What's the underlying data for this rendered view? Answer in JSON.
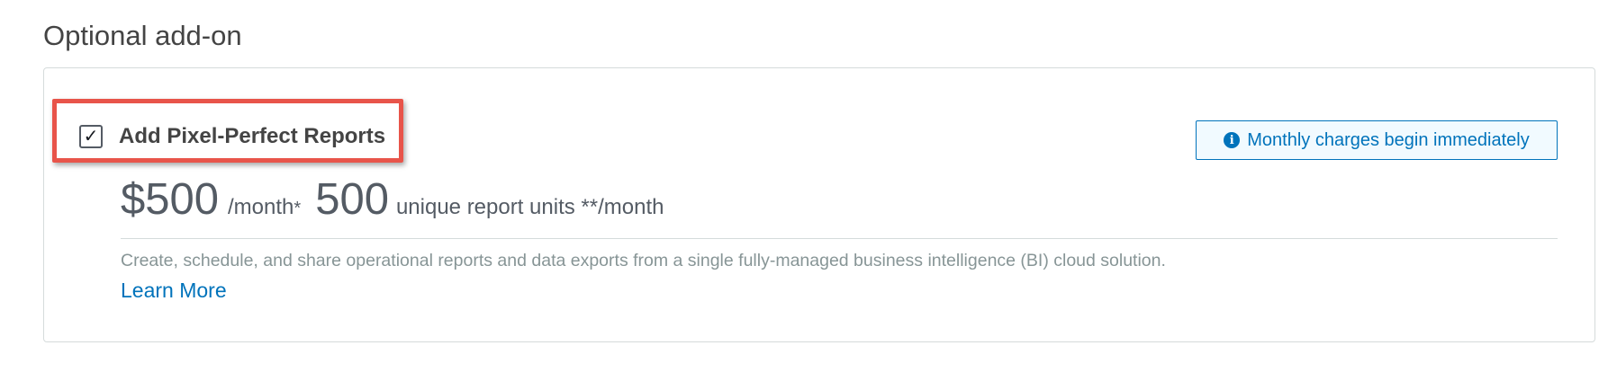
{
  "section": {
    "title": "Optional add-on"
  },
  "addon": {
    "checkbox_glyph": "✓",
    "checked": true,
    "label": "Add Pixel-Perfect Reports",
    "notice": {
      "icon": "info-icon",
      "icon_glyph": "i",
      "text": "Monthly charges begin immediately"
    },
    "pricing": {
      "price": "$500",
      "price_unit": "/month",
      "price_footnote": "*",
      "units_value": "500",
      "units_label": "unique report units **/month"
    },
    "description": "Create, schedule, and share operational reports and data exports from a single fully-managed business intelligence (BI) cloud solution.",
    "learn_more": "Learn More"
  },
  "colors": {
    "highlight": "#e8544a",
    "link": "#0073bb",
    "notice_bg": "#f1faff"
  }
}
